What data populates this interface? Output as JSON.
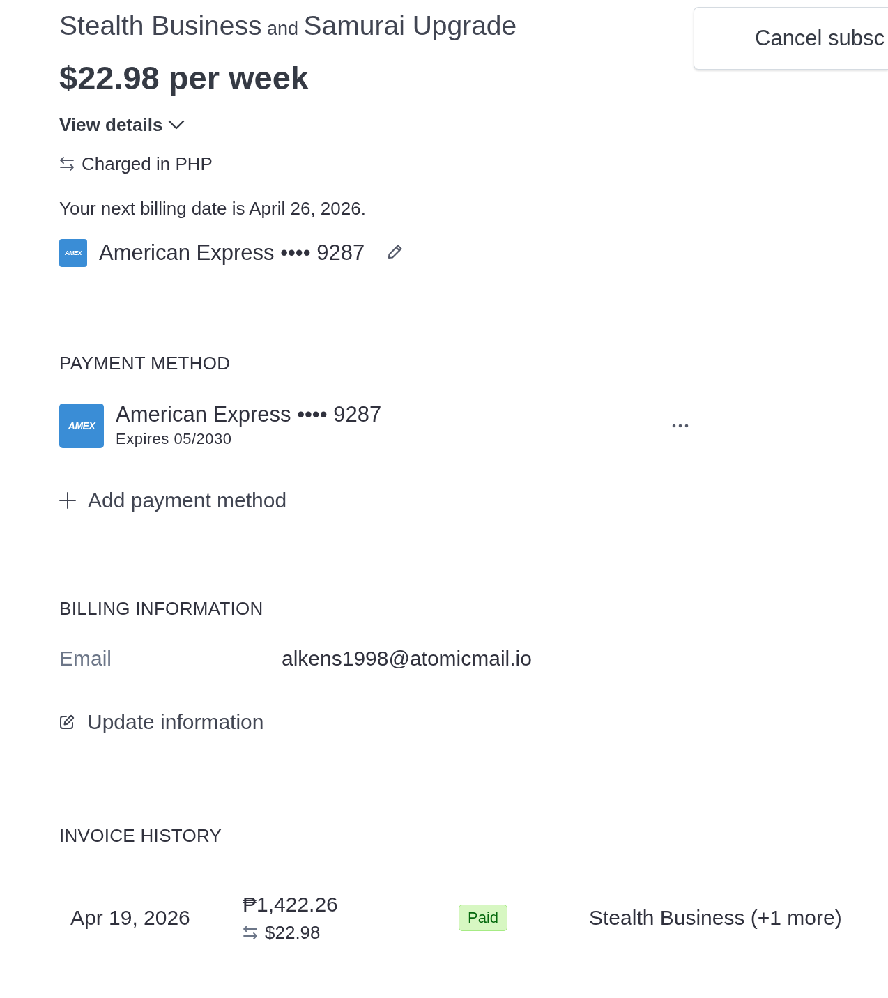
{
  "subscription": {
    "title": {
      "products": [
        "Stealth Business",
        "Samurai Upgrade"
      ],
      "conjunction": "and"
    },
    "price": "$22.98 per week",
    "view_details": {
      "label": "View details",
      "expanded": false
    },
    "currency_note": "Charged in PHP",
    "next_billing": "Your next billing date is April 26, 2026.",
    "payment_card": {
      "brand_mark": "AMEX",
      "label": "American Express •••• 9287"
    }
  },
  "cancel_button": {
    "label": "Cancel subsc"
  },
  "payment_method": {
    "heading": "PAYMENT METHOD",
    "cards": [
      {
        "brand_mark": "AMEX",
        "label": "American Express •••• 9287",
        "expires": "Expires 05/2030"
      }
    ],
    "add_label": "Add payment method"
  },
  "billing_information": {
    "heading": "BILLING INFORMATION",
    "fields": [
      {
        "label": "Email",
        "value": "alkens1998@atomicmail.io"
      }
    ],
    "update_label": "Update information"
  },
  "invoice_history": {
    "heading": "INVOICE HISTORY",
    "rows": [
      {
        "date": "Apr 19, 2026",
        "amount": "₱1,422.26",
        "converted_amount": "$22.98",
        "status": {
          "label": "Paid",
          "kind": "paid"
        },
        "description": "Stealth Business (+1 more)"
      }
    ]
  }
}
